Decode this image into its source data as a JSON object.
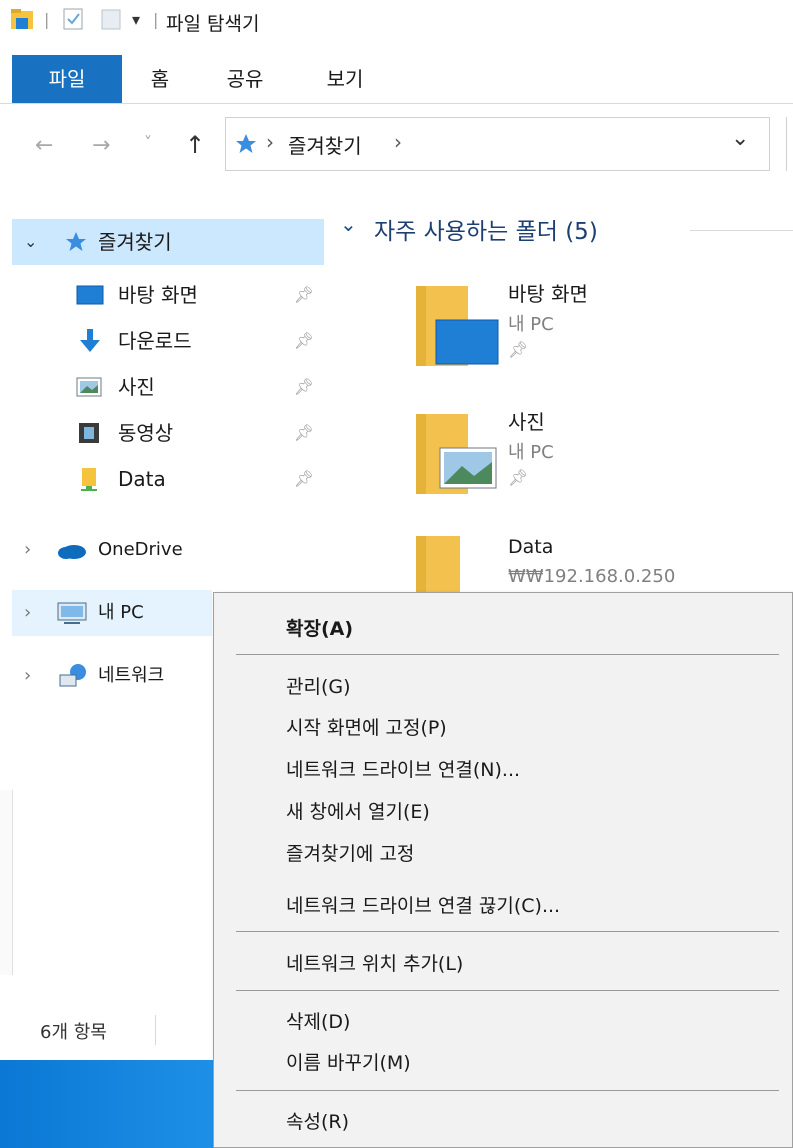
{
  "window": {
    "title": "파일 탐색기",
    "qa_dropdown": "▾"
  },
  "ribbon": {
    "tabs": [
      {
        "label": "파일",
        "active": true
      },
      {
        "label": "홈",
        "active": false
      },
      {
        "label": "공유",
        "active": false
      },
      {
        "label": "보기",
        "active": false
      }
    ]
  },
  "address": {
    "breadcrumb_root_icon": "star-icon",
    "path": "즐겨찾기",
    "sep1": "›",
    "sep2": "›",
    "dropdown": "⌄"
  },
  "nav_buttons": {
    "back": "←",
    "forward": "→",
    "history": "˅",
    "up": "↑"
  },
  "nav_pane": {
    "quick_access": {
      "label": "즐겨찾기",
      "expanded": true
    },
    "pinned": [
      {
        "label": "바탕 화면",
        "icon": "desktop-icon"
      },
      {
        "label": "다운로드",
        "icon": "download-icon"
      },
      {
        "label": "사진",
        "icon": "pictures-icon"
      },
      {
        "label": "동영상",
        "icon": "video-icon"
      },
      {
        "label": "Data",
        "icon": "network-drive-icon"
      }
    ],
    "onedrive": {
      "label": "OneDrive"
    },
    "this_pc": {
      "label": "내 PC"
    },
    "network": {
      "label": "네트워크"
    }
  },
  "content": {
    "section_title": "자주 사용하는 폴더 (5)",
    "folders": [
      {
        "name": "바탕 화면",
        "location": "내 PC",
        "pinned": true
      },
      {
        "name": "사진",
        "location": "내 PC",
        "pinned": true
      },
      {
        "name": "Data",
        "location": "₩₩192.168.0.250",
        "pinned": false
      }
    ]
  },
  "status": {
    "item_count": "6개 항목"
  },
  "context_menu": {
    "expand": "확장(A)",
    "manage": "관리(G)",
    "pin_start": "시작 화면에 고정(P)",
    "map_drive": "네트워크 드라이브 연결(N)...",
    "open_new": "새 창에서 열기(E)",
    "pin_quick": "즐겨찾기에 고정",
    "disconnect": "네트워크 드라이브 연결 끊기(C)...",
    "add_location": "네트워크 위치 추가(L)",
    "delete": "삭제(D)",
    "rename": "이름 바꾸기(M)",
    "properties": "속성(R)"
  },
  "colors": {
    "accent": "#1971c2",
    "selection": "#cce8ff",
    "folder": "#f5c33d"
  }
}
